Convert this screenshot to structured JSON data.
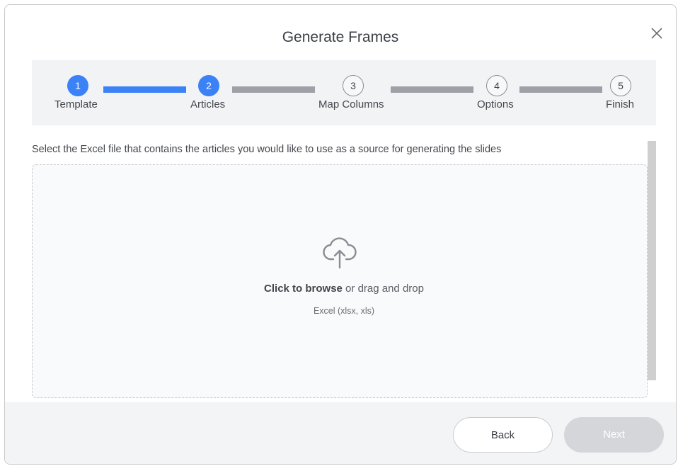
{
  "dialog": {
    "title": "Generate Frames",
    "close_icon": "close-icon"
  },
  "stepper": {
    "steps": [
      {
        "number": "1",
        "label": "Template",
        "state": "completed"
      },
      {
        "number": "2",
        "label": "Articles",
        "state": "current"
      },
      {
        "number": "3",
        "label": "Map Columns",
        "state": "upcoming"
      },
      {
        "number": "4",
        "label": "Options",
        "state": "upcoming"
      },
      {
        "number": "5",
        "label": "Finish",
        "state": "upcoming"
      }
    ],
    "connector_states": [
      "completed",
      "upcoming",
      "upcoming",
      "upcoming"
    ]
  },
  "upload": {
    "instruction": "Select the Excel file that contains the articles you would like to use as a source for generating the slides",
    "browse_label": "Click to browse",
    "drag_label": " or drag and drop",
    "formats": "Excel (xlsx, xls)",
    "icon": "cloud-upload-icon"
  },
  "footer": {
    "back_label": "Back",
    "next_label": "Next",
    "next_enabled": false
  },
  "colors": {
    "accent": "#3b82f6",
    "inactive": "#9da0a6",
    "disabled_button": "#d4d6da"
  }
}
